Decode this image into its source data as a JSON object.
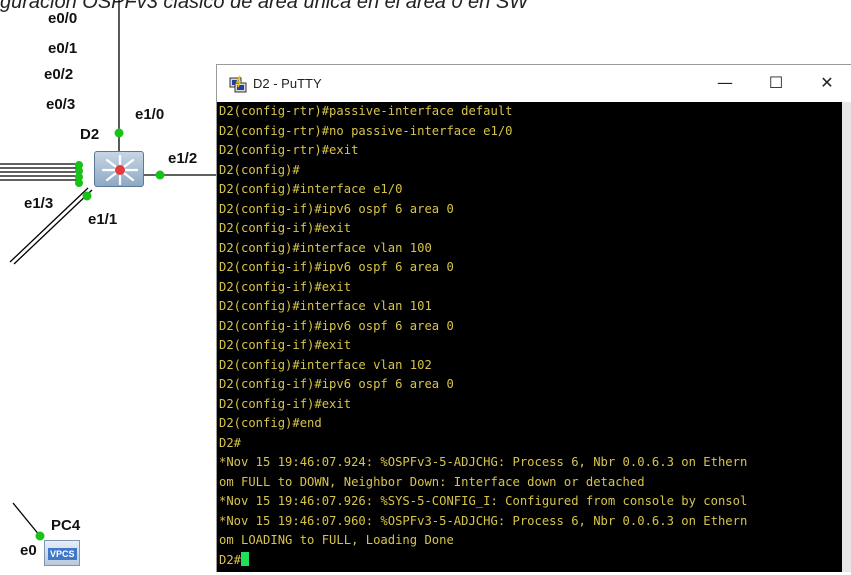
{
  "caption": "guración OSPFv3 clásico de área única en el área 0 en SW",
  "topology": {
    "interfaces_top": [
      "e0/0",
      "e0/1",
      "e0/2",
      "e0/3"
    ],
    "switch_name": "D2",
    "link_labels": {
      "e10": "e1/0",
      "e12": "e1/2",
      "e13": "e1/3",
      "e11": "e1/1"
    },
    "pc_name": "PC4",
    "pc_interface": "e0",
    "pc_badge": "VPCS",
    "link_status_color": "#19c219"
  },
  "window": {
    "title": "D2 - PuTTY",
    "minimize": "—",
    "maximize": "☐",
    "close": "✕"
  },
  "terminal": {
    "text_color": "#d7c44a",
    "background": "#000000",
    "cursor_color": "#1ee05a",
    "lines": [
      "D2(config-rtr)#passive-interface default",
      "D2(config-rtr)#no passive-interface e1/0",
      "D2(config-rtr)#exit",
      "D2(config)#",
      "D2(config)#interface e1/0",
      "D2(config-if)#ipv6 ospf 6 area 0",
      "D2(config-if)#exit",
      "D2(config)#interface vlan 100",
      "D2(config-if)#ipv6 ospf 6 area 0",
      "D2(config-if)#exit",
      "D2(config)#interface vlan 101",
      "D2(config-if)#ipv6 ospf 6 area 0",
      "D2(config-if)#exit",
      "D2(config)#interface vlan 102",
      "D2(config-if)#ipv6 ospf 6 area 0",
      "D2(config-if)#exit",
      "D2(config)#end",
      "D2#",
      "*Nov 15 19:46:07.924: %OSPFv3-5-ADJCHG: Process 6, Nbr 0.0.6.3 on Ethern",
      "om FULL to DOWN, Neighbor Down: Interface down or detached",
      "*Nov 15 19:46:07.926: %SYS-5-CONFIG_I: Configured from console by consol",
      "*Nov 15 19:46:07.960: %OSPFv3-5-ADJCHG: Process 6, Nbr 0.0.6.3 on Ethern",
      "om LOADING to FULL, Loading Done"
    ],
    "prompt": "D2#"
  }
}
